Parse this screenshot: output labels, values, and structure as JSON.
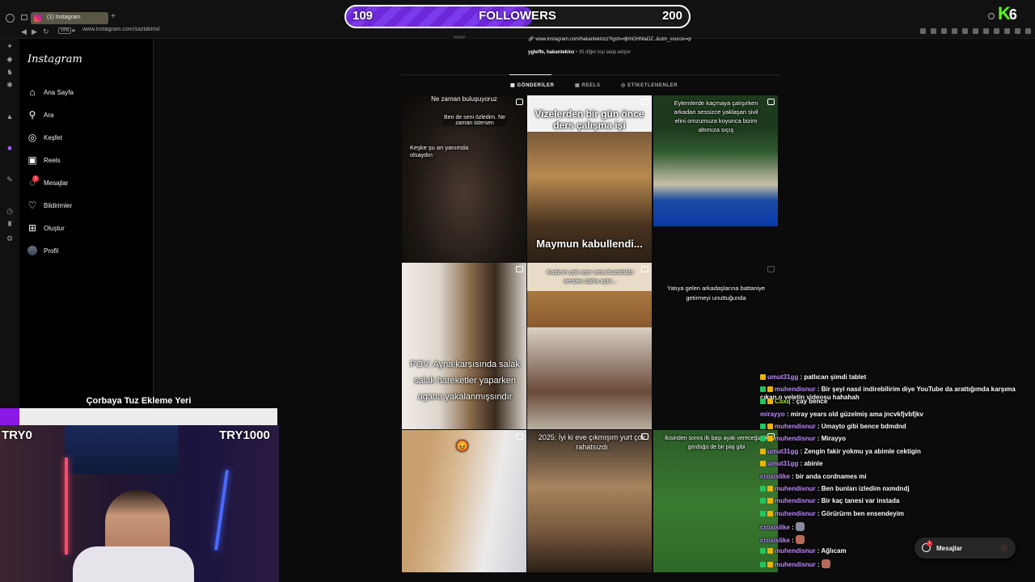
{
  "followers": {
    "current": "109",
    "label": "FOLLOWERS",
    "target": "200",
    "progress": 0.545
  },
  "browser": {
    "tab_title": "(1) Instagram",
    "url": "www.instagram.com/saztakimi/",
    "vpn": "VPN"
  },
  "kick": {
    "logo": "K",
    "badge": "6"
  },
  "instagram": {
    "logo": "Instagram",
    "nav": [
      "Ana Sayfa",
      "Ara",
      "Keşfet",
      "Reels",
      "Mesajlar",
      "Bildirimler",
      "Oluştur",
      "Profil"
    ],
    "message_badge": "1",
    "bio_link": "www.instagram.com/hakantekinzz?igsh=djhhOHNlaDZ..&utm_source=qr",
    "followed_by_users": "ygteffe, hakantekinz",
    "followed_by_rest": "• 35 diğer kişi takip ediyor",
    "tabs": [
      "GÖNDERİLER",
      "REELS",
      "ETİKETLENENLER"
    ],
    "posts": [
      {
        "captions": [
          "Ne zaman buluşuyoruz",
          "Ben de seni özledim. Ne zaman istersen",
          "Keşke şu an yanımda olsaydın"
        ]
      },
      {
        "captions": [
          "Vizelerden bir gün önce ders çalışma işi",
          "Maymun kabullendi..."
        ]
      },
      {
        "captions": [
          "Eylemlerde kaçmaya çalışırken arkadan sessizce yaklaşan sivil elini omzumuza koyunca bizim altımıza sıçış"
        ]
      },
      {
        "captions": [
          "POV: Ayna karşısında salak salak hareketler yaparken agana yakalanmışsındır"
        ]
      },
      {
        "captions": [
          "Kadının çok açtır ama buzdolabı senden daha açtır..."
        ]
      },
      {
        "captions": [
          "Yatıya gelen arkadaşlarına battaniye getirmeyi unuttuğunda"
        ]
      },
      {
        "captions": [
          "😡"
        ]
      },
      {
        "captions": [
          "2025: İyi ki eve çıkmışım yurt çok rahatsızdı"
        ]
      },
      {
        "captions": [
          "İkisinden sonra ilk başı ayak vereceğiz ilk gördüğü de bir plaj gibi"
        ]
      }
    ],
    "messages_pill": "Mesajlar",
    "messages_pill_badge": "1"
  },
  "goal": {
    "title": "Çorbaya Tuz Ekleme Yeri",
    "min": "TRY0",
    "max": "TRY1000",
    "progress": 0.07
  },
  "chat": [
    {
      "user": "umut31gg",
      "text": "patlıcan şimdi tablet",
      "color": "#c08cff"
    },
    {
      "user": "muhendisnur",
      "text": "Bir şeyi nasıl indirebilirim diye YouTube da arattığımda karşıma çıkan o veletin videosu hahahah",
      "color": "#c08cff"
    },
    {
      "user": "Caxq",
      "text": "çay bence",
      "color": "#a3e635"
    },
    {
      "user": "mirayyo",
      "text": "miray years old güzelmiş ama jncvkfjvbfjkv",
      "color": "#c08cff"
    },
    {
      "user": "muhendisnur",
      "text": "Umayto gibi bence bdmdnd",
      "color": "#c08cff"
    },
    {
      "user": "muhendisnur",
      "text": "Mirayyo",
      "color": "#c08cff"
    },
    {
      "user": "umut31gg",
      "text": "Zengin fakir yokmu ya abimle cektigin",
      "color": "#c08cff"
    },
    {
      "user": "umut31gg",
      "text": "abinle",
      "color": "#c08cff"
    },
    {
      "user": "croxislike",
      "text": "bir anda cordnames mi",
      "color": "#c08cff"
    },
    {
      "user": "muhendisnur",
      "text": "Ben bunları izledim nxmdndj",
      "color": "#c08cff"
    },
    {
      "user": "muhendisnur",
      "text": "Bir kaç tanesi var instada",
      "color": "#c08cff"
    },
    {
      "user": "muhendisnur",
      "text": "Görürürm ben ensendeyim",
      "color": "#c08cff"
    },
    {
      "user": "croxislike",
      "text": "",
      "color": "#c08cff"
    },
    {
      "user": "croxislike",
      "text": "",
      "color": "#c08cff"
    },
    {
      "user": "muhendisnur",
      "text": "Ağlıcam",
      "color": "#c08cff"
    },
    {
      "user": "muhendisnur",
      "text": "",
      "color": "#c08cff"
    }
  ]
}
